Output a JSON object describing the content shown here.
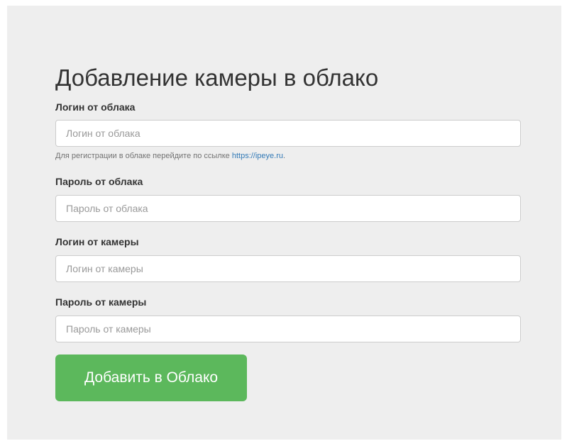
{
  "form": {
    "title": "Добавление камеры в облако",
    "cloud_login": {
      "label": "Логин от облака",
      "placeholder": "Логин от облака",
      "value": ""
    },
    "help": {
      "text": "Для регистрации в облаке перейдите по ссылке ",
      "link_text": "https://ipeye.ru",
      "suffix": "."
    },
    "cloud_password": {
      "label": "Пароль от облака",
      "placeholder": "Пароль от облака",
      "value": ""
    },
    "camera_login": {
      "label": "Логин от камеры",
      "placeholder": "Логин от камеры",
      "value": ""
    },
    "camera_password": {
      "label": "Пароль от камеры",
      "placeholder": "Пароль от камеры",
      "value": ""
    },
    "submit_label": "Добавить в Облако"
  },
  "colors": {
    "panel_bg": "#eeeeee",
    "button_bg": "#5cb85c",
    "link": "#337ab7"
  }
}
